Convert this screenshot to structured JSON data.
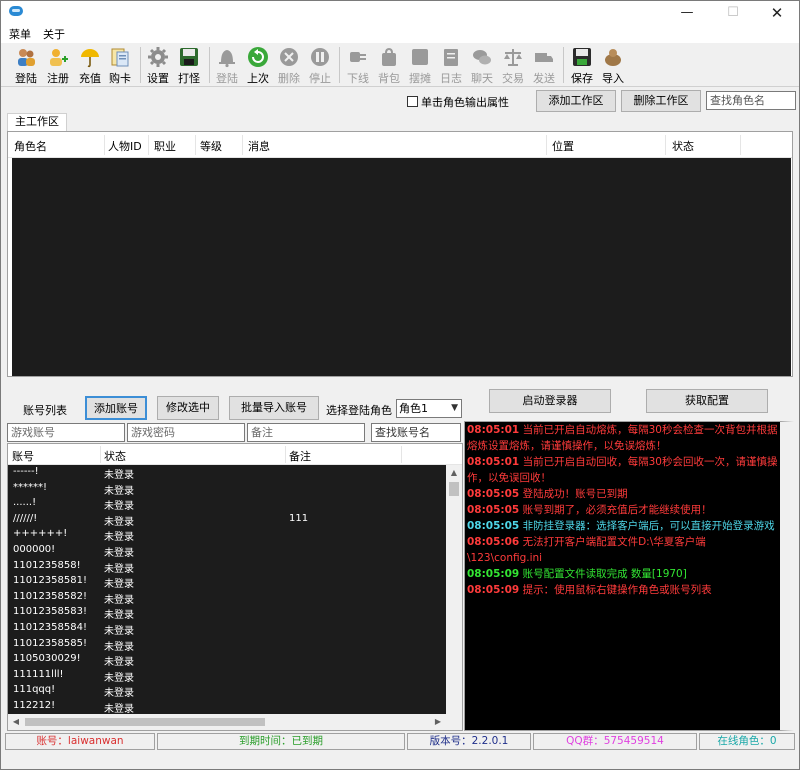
{
  "window": {
    "min_glyph": "—",
    "max_glyph": "☐",
    "close_glyph": "✕"
  },
  "menu": {
    "main": "菜单",
    "about": "关于"
  },
  "toolbar": {
    "login": "登陆",
    "register": "注册",
    "recharge": "充值",
    "buy_card": "购卡",
    "settings": "设置",
    "fight": "打怪",
    "logout": "登陆",
    "last": "上次",
    "delete": "删除",
    "stop": "停止",
    "offline": "下线",
    "bag": "背包",
    "stall": "摆摊",
    "log": "日志",
    "chat": "聊天",
    "trade": "交易",
    "send": "发送",
    "save": "保存",
    "import": "导入"
  },
  "top_controls": {
    "output_attr_label": "单击角色输出属性",
    "add_workspace": "添加工作区",
    "delete_workspace": "删除工作区",
    "find_role_placeholder": "查找角色名"
  },
  "tabs": {
    "main": "主工作区"
  },
  "main_grid": {
    "columns": {
      "role_name": "角色名",
      "char_id": "人物ID",
      "job": "职业",
      "level": "等级",
      "message": "消息",
      "position": "位置",
      "status": "状态"
    }
  },
  "account_controls": {
    "account_list_label": "账号列表",
    "add_account": "添加账号",
    "modify_selected": "修改选中",
    "batch_import": "批量导入账号",
    "select_role_label": "选择登陆角色",
    "selected_role": "角色1",
    "start_launcher": "启动登录器",
    "get_config": "获取配置"
  },
  "account_inputs": {
    "account_placeholder": "游戏账号",
    "password_placeholder": "游戏密码",
    "remark_placeholder": "备注",
    "find_account": "查找账号名"
  },
  "account_list": {
    "columns": {
      "account": "账号",
      "status": "状态",
      "remark": "备注"
    },
    "rows": [
      {
        "account": "------!",
        "status": "未登录",
        "remark": ""
      },
      {
        "account": "******!",
        "status": "未登录",
        "remark": ""
      },
      {
        "account": "......!",
        "status": "未登录",
        "remark": ""
      },
      {
        "account": "//////!",
        "status": "未登录",
        "remark": "111"
      },
      {
        "account": "++++++!",
        "status": "未登录",
        "remark": ""
      },
      {
        "account": "000000!",
        "status": "未登录",
        "remark": ""
      },
      {
        "account": "1101235858!",
        "status": "未登录",
        "remark": ""
      },
      {
        "account": "11012358581!",
        "status": "未登录",
        "remark": ""
      },
      {
        "account": "11012358582!",
        "status": "未登录",
        "remark": ""
      },
      {
        "account": "11012358583!",
        "status": "未登录",
        "remark": ""
      },
      {
        "account": "11012358584!",
        "status": "未登录",
        "remark": ""
      },
      {
        "account": "11012358585!",
        "status": "未登录",
        "remark": ""
      },
      {
        "account": "1105030029!",
        "status": "未登录",
        "remark": ""
      },
      {
        "account": "111111lll!",
        "status": "未登录",
        "remark": ""
      },
      {
        "account": "111qqq!",
        "status": "未登录",
        "remark": ""
      },
      {
        "account": "112212!",
        "status": "未登录",
        "remark": ""
      }
    ]
  },
  "log": {
    "colors": {
      "red": "#ff3b3b",
      "cyan": "#4ed6e8",
      "green": "#33e633"
    },
    "lines": [
      {
        "ts": "08:05:01",
        "text": "当前已开启自动熔炼，每隔30秒会检查一次背包并根据熔炼设置熔炼，请谨慎操作，以免误熔炼！",
        "color": "red"
      },
      {
        "ts": "08:05:01",
        "text": "当前已开启自动回收，每隔30秒会回收一次，请谨慎操作，以免误回收！",
        "color": "red"
      },
      {
        "ts": "08:05:05",
        "text": "登陆成功！账号已到期",
        "color": "red"
      },
      {
        "ts": "08:05:05",
        "text": "账号到期了，必须充值后才能继续使用！",
        "color": "red"
      },
      {
        "ts": "08:05:05",
        "text": "非防挂登录器：选择客户端后，可以直接开始登录游戏",
        "color": "cyan"
      },
      {
        "ts": "08:05:06",
        "text": "无法打开客户端配置文件D:\\华夏客户端\\123\\config.ini",
        "color": "red"
      },
      {
        "ts": "08:05:09",
        "text": "账号配置文件读取完成 数量[1970]",
        "color": "green"
      },
      {
        "ts": "08:05:09",
        "text": "提示：使用鼠标右键操作角色或账号列表",
        "color": "red"
      }
    ]
  },
  "statusbar": {
    "account": "账号：laiwanwan",
    "expire": "到期时间：已到期",
    "version": "版本号：2.2.0.1",
    "qq_group": "QQ群：575459514",
    "online_roles": "在线角色：0"
  }
}
